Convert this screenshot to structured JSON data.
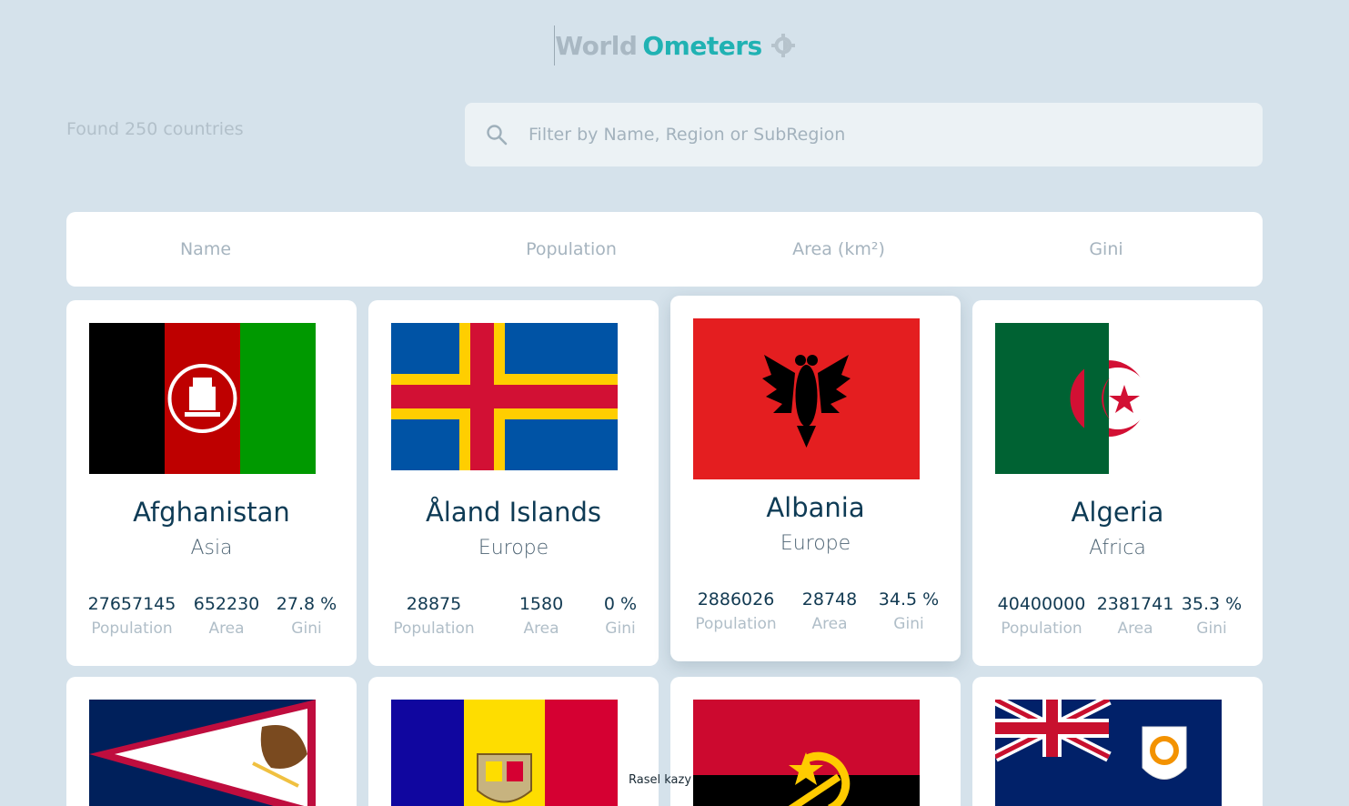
{
  "header": {
    "brand_part1": "World",
    "brand_part2": "Ometers",
    "theme_icon": "sun-icon"
  },
  "toolbar": {
    "found_text": "Found 250 countries",
    "search_placeholder": "Filter by Name, Region or SubRegion",
    "search_value": ""
  },
  "sort_headers": [
    "Name",
    "Population",
    "Area (km²)",
    "Gini"
  ],
  "stat_labels": {
    "population": "Population",
    "area": "Area",
    "gini": "Gini"
  },
  "countries": [
    {
      "name": "Afghanistan",
      "region": "Asia",
      "population": "27657145",
      "area": "652230",
      "gini": "27.8 %",
      "flag": "afghanistan"
    },
    {
      "name": "Åland Islands",
      "region": "Europe",
      "population": "28875",
      "area": "1580",
      "gini": "0 %",
      "flag": "aland"
    },
    {
      "name": "Albania",
      "region": "Europe",
      "population": "2886026",
      "area": "28748",
      "gini": "34.5 %",
      "flag": "albania"
    },
    {
      "name": "Algeria",
      "region": "Africa",
      "population": "40400000",
      "area": "2381741",
      "gini": "35.3 %",
      "flag": "algeria"
    },
    {
      "flag": "american-samoa"
    },
    {
      "flag": "andorra"
    },
    {
      "flag": "angola"
    },
    {
      "flag": "anguilla"
    }
  ],
  "footer": {
    "text": "Rasel kazy"
  },
  "colors": {
    "background": "#d5e2eb",
    "accent": "#20b2b3",
    "muted": "#a9b8c3"
  }
}
